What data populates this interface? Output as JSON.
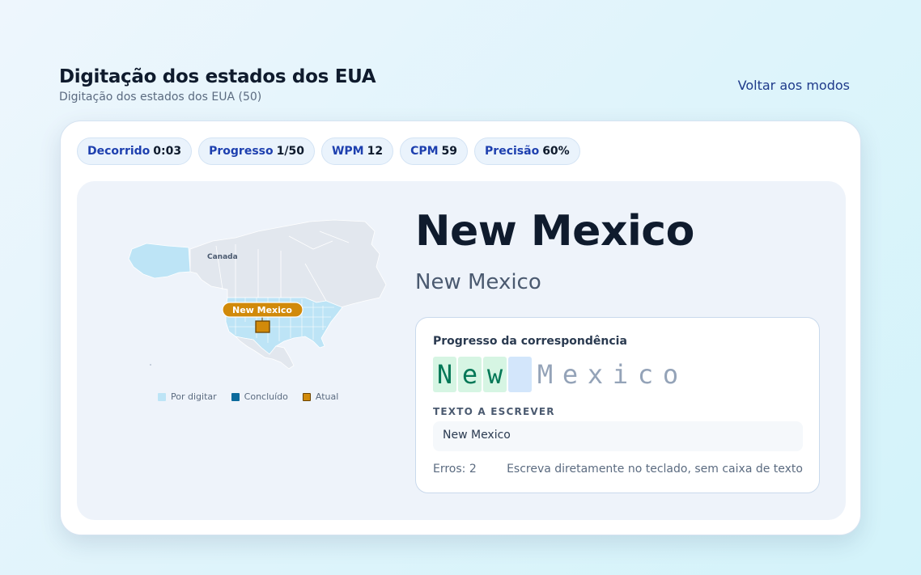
{
  "header": {
    "title": "Digitação dos estados dos EUA",
    "subtitle": "Digitação dos estados dos EUA (50)",
    "back_label": "Voltar aos modos"
  },
  "stats": [
    {
      "label": "Decorrido",
      "value": "0:03"
    },
    {
      "label": "Progresso",
      "value": "1/50"
    },
    {
      "label": "WPM",
      "value": "12"
    },
    {
      "label": "CPM",
      "value": "59"
    },
    {
      "label": "Precisão",
      "value": "60%"
    }
  ],
  "map": {
    "canada_label": "Canada",
    "current_state_tag": "New Mexico",
    "legend": {
      "todo": "Por digitar",
      "done": "Concluído",
      "current": "Atual"
    },
    "colors": {
      "todo": "#bde4f6",
      "done": "#0b6a9c",
      "current": "#d18a0a",
      "land": "#e2e7ee"
    }
  },
  "prompt": {
    "title": "New Mexico",
    "subtitle": "New Mexico"
  },
  "match": {
    "label": "Progresso da correspondência",
    "chars": [
      {
        "c": "N",
        "state": "correct"
      },
      {
        "c": "e",
        "state": "correct"
      },
      {
        "c": "w",
        "state": "correct"
      },
      {
        "c": " ",
        "state": "cursor"
      },
      {
        "c": "M",
        "state": "pending"
      },
      {
        "c": "e",
        "state": "pending"
      },
      {
        "c": "x",
        "state": "pending"
      },
      {
        "c": "i",
        "state": "pending"
      },
      {
        "c": "c",
        "state": "pending"
      },
      {
        "c": "o",
        "state": "pending"
      }
    ],
    "target_label": "TEXTO A ESCREVER",
    "target_text": "New Mexico",
    "errors": "Erros: 2",
    "hint": "Escreva diretamente no teclado, sem caixa de texto"
  },
  "accent": "#1e40af"
}
